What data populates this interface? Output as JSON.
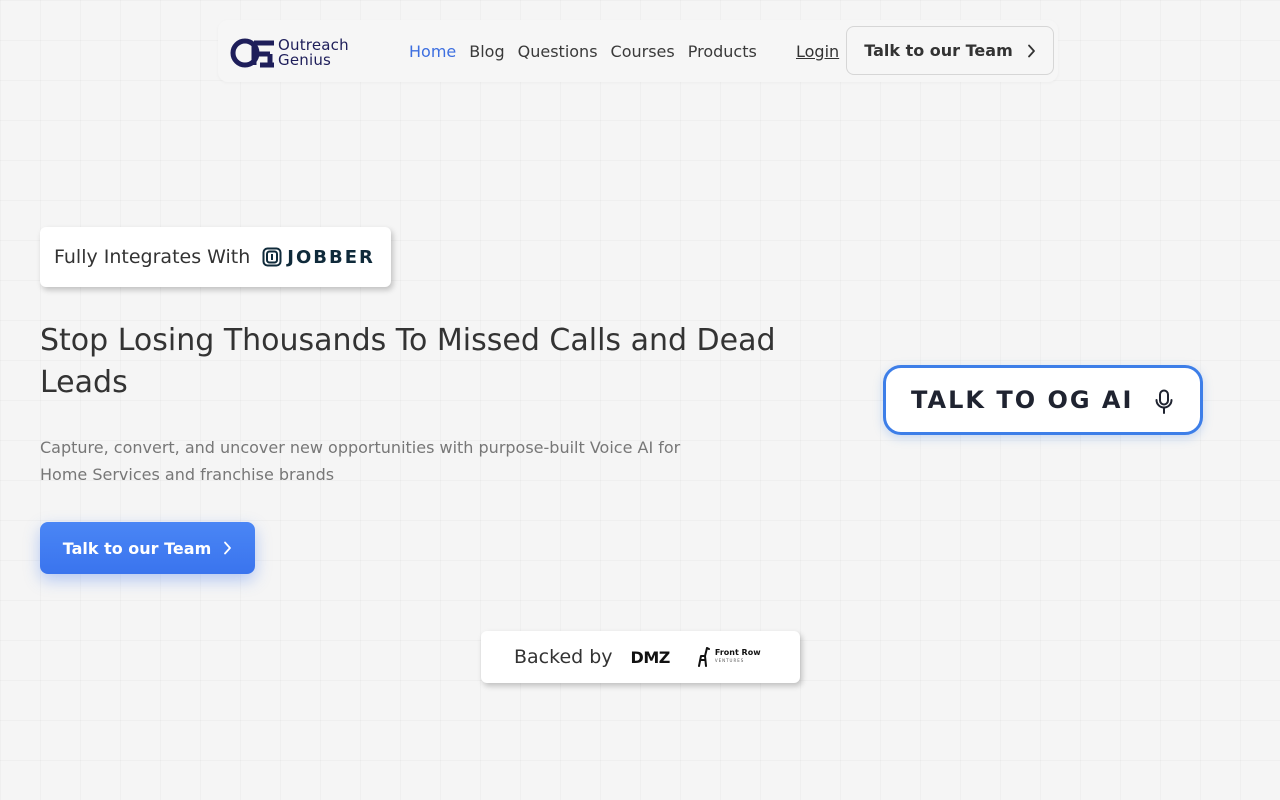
{
  "brand": {
    "name_line1": "Outreach",
    "name_line2": "Genius",
    "primary_color": "#1e1e5a",
    "accent_color": "#3d6fe0"
  },
  "nav": {
    "links": [
      {
        "label": "Home",
        "active": true
      },
      {
        "label": "Blog",
        "active": false
      },
      {
        "label": "Questions",
        "active": false
      },
      {
        "label": "Courses",
        "active": false
      },
      {
        "label": "Products",
        "active": false
      }
    ],
    "login_label": "Login",
    "cta_label": "Talk to our Team",
    "cta_icon": "chevron-right-icon"
  },
  "integration": {
    "label": "Fully Integrates With",
    "partner": "JOBBER"
  },
  "hero": {
    "title": "Stop Losing Thousands To Missed Calls and Dead Leads",
    "subtitle": "Capture, convert, and uncover new opportunities with purpose-built Voice AI for Home Services and franchise brands",
    "cta_label": "Talk to our Team",
    "cta_icon": "chevron-right-icon",
    "cta_color": "#3a74ee"
  },
  "voice_widget": {
    "label": "TALK TO OG AI",
    "icon": "microphone-icon",
    "border_color": "#3d7ee8"
  },
  "backed_by": {
    "label": "Backed by",
    "backers": [
      {
        "name": "DMZ"
      },
      {
        "name": "Front Row",
        "subtitle": "VENTURES"
      }
    ]
  }
}
